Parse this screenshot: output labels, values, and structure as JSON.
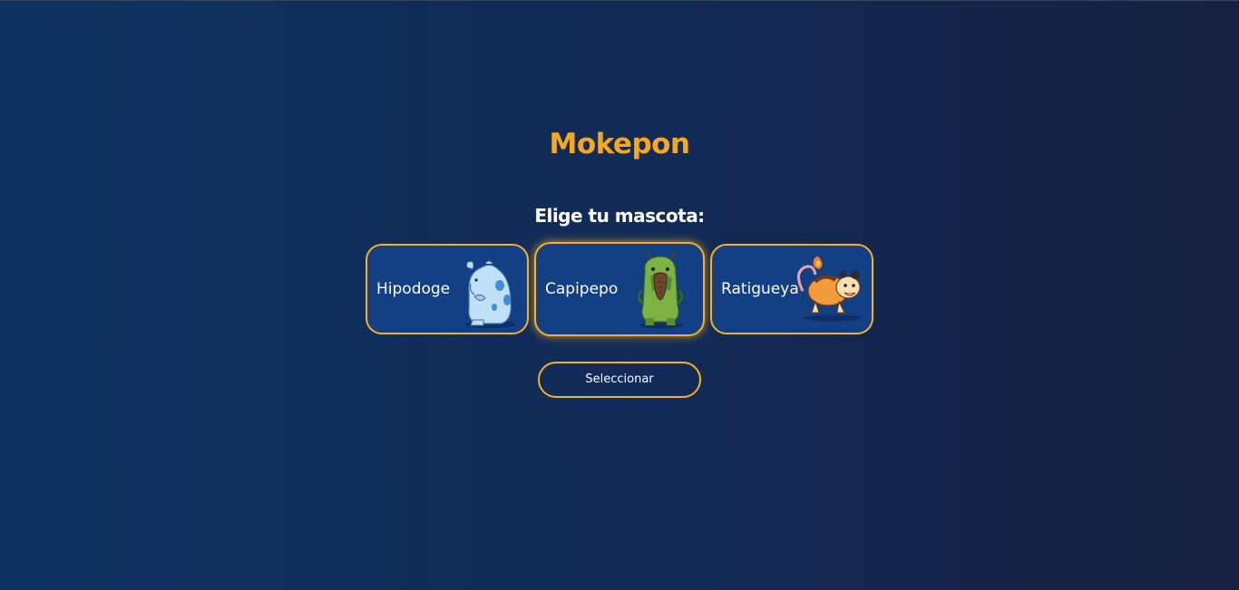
{
  "game": {
    "title": "Mokepon",
    "subtitle": "Elige tu mascota:",
    "colors": {
      "accent": "#f7a81b",
      "card_bg": "#133f85",
      "bg_left": "#0e3260",
      "bg_right": "#18203f"
    },
    "pets": [
      {
        "name": "Hipodoge",
        "image": "hipodoge-creature"
      },
      {
        "name": "Capipepo",
        "image": "capipepo-creature",
        "selected": true
      },
      {
        "name": "Ratigueya",
        "image": "ratigueya-creature"
      }
    ],
    "select_button_label": "Seleccionar"
  }
}
